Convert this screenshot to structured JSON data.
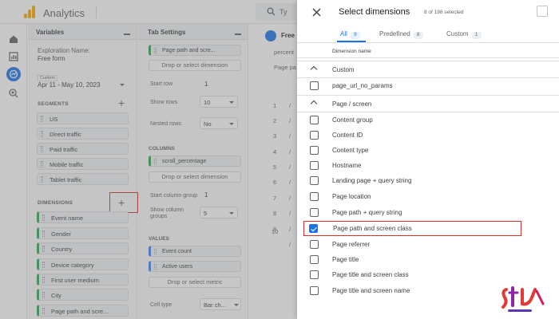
{
  "app": {
    "title": "Analytics",
    "search_text": "Ty"
  },
  "variables": {
    "title": "Variables",
    "exploration_label": "Exploration Name:",
    "exploration_value": "Free form",
    "date_tag": "Custom",
    "date_range": "Apr 11 - May 10, 2023",
    "segments_label": "SEGMENTS",
    "segments": [
      "US",
      "Direct traffic",
      "Paid traffic",
      "Mobile traffic",
      "Tablet traffic"
    ],
    "dimensions_label": "DIMENSIONS",
    "dimensions": [
      "Event name",
      "Gender",
      "Country",
      "Device category",
      "First user medium",
      "City",
      "Page path and scre..."
    ]
  },
  "tab_settings": {
    "title": "Tab Settings",
    "rows_chip": "Page path and scre...",
    "drop_dimension": "Drop or select dimension",
    "start_row_label": "Start row",
    "start_row_value": "1",
    "show_rows_label": "Show rows",
    "show_rows_value": "10",
    "nested_rows_label": "Nested rows",
    "nested_rows_value": "No",
    "columns_label": "COLUMNS",
    "columns_chip": "scroll_percentage",
    "drop_dimension_2": "Drop or select dimension",
    "start_col_label": "Start column group",
    "start_col_value": "1",
    "show_col_label": "Show column groups",
    "show_col_value": "5",
    "values_label": "VALUES",
    "values": [
      "Event count",
      "Active users"
    ],
    "drop_metric": "Drop or select metric",
    "cell_type_label": "Cell type",
    "cell_type_value": "Bar ch..."
  },
  "canvas": {
    "tab_name": "Free",
    "col1": "percent",
    "col2": "Page pa",
    "row_numbers": [
      "1",
      "2",
      "3",
      "4",
      "5",
      "6",
      "7",
      "8",
      "9",
      "10"
    ],
    "row_prefixes": [
      "/",
      "/",
      "/",
      "/",
      "/",
      "/",
      "/",
      "/",
      "/",
      "/"
    ]
  },
  "drawer": {
    "title": "Select dimensions",
    "count": "8 of 198 selected",
    "tabs": [
      {
        "label": "All",
        "count": "9"
      },
      {
        "label": "Predefined",
        "count": "8"
      },
      {
        "label": "Custom",
        "count": "1"
      }
    ],
    "column_header": "Dimension name",
    "groups": {
      "custom": "Custom",
      "page_screen": "Page / screen"
    },
    "custom_items": [
      "page_url_no_params"
    ],
    "page_items": [
      "Content group",
      "Content ID",
      "Content type",
      "Hostname",
      "Landing page + query string",
      "Page location",
      "Page path + query string",
      "Page path and screen class",
      "Page referrer",
      "Page title",
      "Page title and screen class",
      "Page title and screen name"
    ],
    "checked_item": "Page path and screen class"
  },
  "colors": {
    "accent": "#1a73e8",
    "highlight": "#d93025",
    "logo": "#f9ab00"
  }
}
